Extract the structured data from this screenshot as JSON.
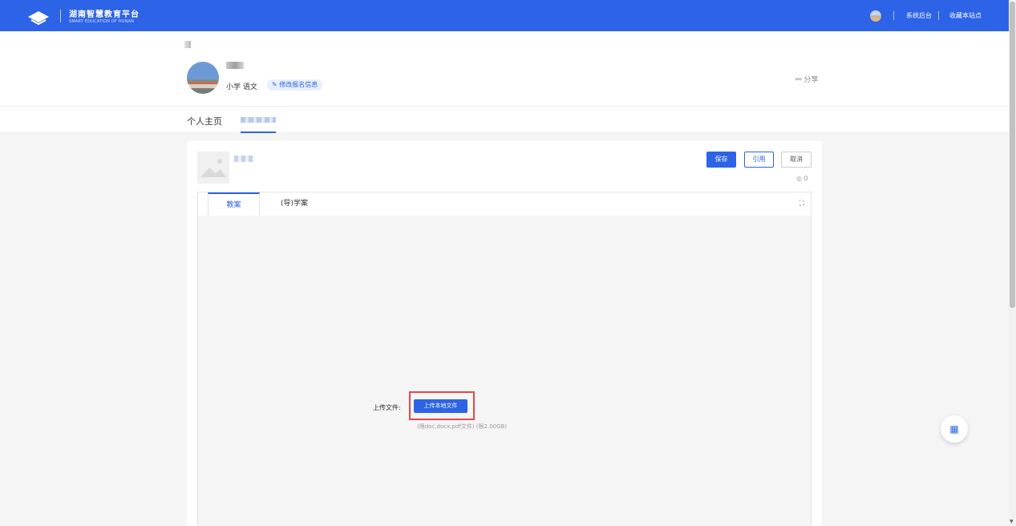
{
  "topbar": {
    "logo_title": "湖南智慧教育平台",
    "logo_subtitle": "SMART EDUCATION OF HUNAN",
    "link_admin": "系统后台",
    "link_bookmark": "收藏本站点"
  },
  "profile": {
    "subject": "小学 语文",
    "edit_label": "修改报名信息",
    "share_label": "分享"
  },
  "nav": {
    "home": "个人主页"
  },
  "card": {
    "save": "保存",
    "quote": "引用",
    "cancel": "取消",
    "view_count": "0",
    "tabs": [
      "教案",
      "(导)学案"
    ],
    "upload_label": "上传文件:",
    "upload_button": "上传本地文件",
    "upload_hint": "(限doc,docx,pdf文件) (限2.00GB)"
  },
  "icons": {
    "accent": "#2d63e6",
    "highlight": "#e24a4a"
  }
}
